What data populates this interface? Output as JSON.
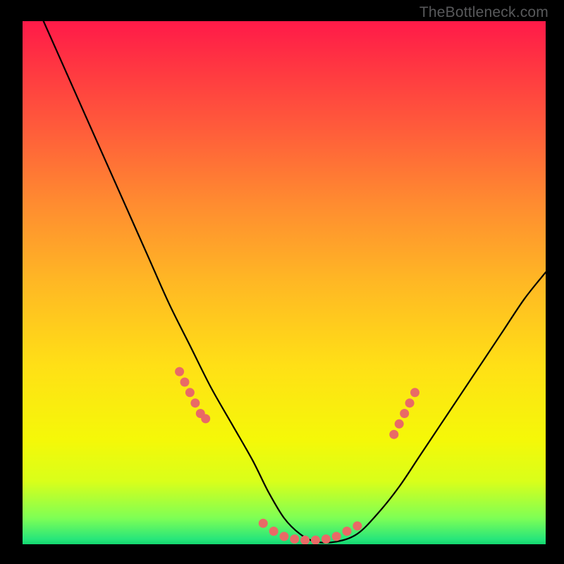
{
  "watermark": {
    "text": "TheBottleneck.com"
  },
  "colors": {
    "page_bg": "#000000",
    "curve_stroke": "#000000",
    "dot_fill": "#e96a66",
    "grad_top": "#ff1a49",
    "grad_bottom": "#13D66F"
  },
  "chart_data": {
    "type": "line",
    "title": "",
    "xlabel": "",
    "ylabel": "",
    "xlim": [
      0,
      100
    ],
    "ylim": [
      0,
      100
    ],
    "grid": false,
    "legend": false,
    "series": [
      {
        "name": "bottleneck-curve",
        "x": [
          4,
          8,
          12,
          16,
          20,
          24,
          28,
          32,
          36,
          40,
          44,
          47,
          50,
          53,
          56,
          60,
          64,
          68,
          72,
          76,
          80,
          84,
          88,
          92,
          96,
          100
        ],
        "y": [
          100,
          91,
          82,
          73,
          64,
          55,
          46,
          38,
          30,
          23,
          16,
          10,
          5,
          2,
          0.5,
          0.5,
          2,
          6,
          11,
          17,
          23,
          29,
          35,
          41,
          47,
          52
        ]
      }
    ],
    "dot_clusters": [
      {
        "name": "left-cluster",
        "points": [
          {
            "x": 30,
            "y": 33
          },
          {
            "x": 31,
            "y": 31
          },
          {
            "x": 32,
            "y": 29
          },
          {
            "x": 33,
            "y": 27
          },
          {
            "x": 34,
            "y": 25
          },
          {
            "x": 35,
            "y": 24
          }
        ]
      },
      {
        "name": "trough-cluster",
        "points": [
          {
            "x": 46,
            "y": 4
          },
          {
            "x": 48,
            "y": 2.5
          },
          {
            "x": 50,
            "y": 1.5
          },
          {
            "x": 52,
            "y": 1
          },
          {
            "x": 54,
            "y": 0.8
          },
          {
            "x": 56,
            "y": 0.8
          },
          {
            "x": 58,
            "y": 1
          },
          {
            "x": 60,
            "y": 1.5
          },
          {
            "x": 62,
            "y": 2.5
          },
          {
            "x": 64,
            "y": 3.5
          }
        ]
      },
      {
        "name": "right-cluster",
        "points": [
          {
            "x": 71,
            "y": 21
          },
          {
            "x": 72,
            "y": 23
          },
          {
            "x": 73,
            "y": 25
          },
          {
            "x": 74,
            "y": 27
          },
          {
            "x": 75,
            "y": 29
          }
        ]
      }
    ]
  }
}
